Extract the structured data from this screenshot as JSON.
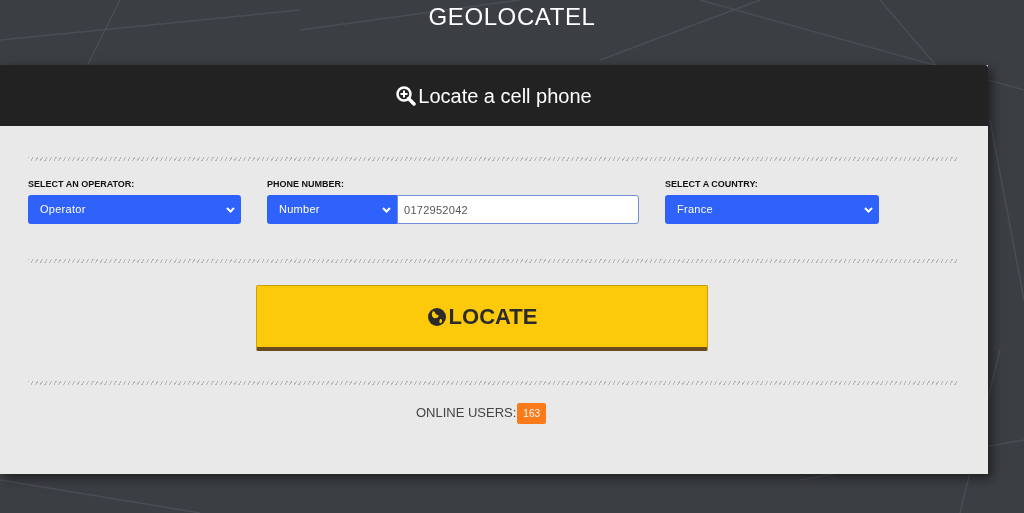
{
  "site_title": "GEOLOCATEL",
  "card": {
    "title": "Locate a cell phone"
  },
  "fields": [
    {
      "kind": "select",
      "label": "SELECT AN OPERATOR:",
      "value": "Operator"
    },
    {
      "kind": "phone",
      "label": "PHONE NUMBER:",
      "prefix": "Number",
      "value": "0172952042"
    },
    {
      "kind": "select",
      "label": "SELECT A COUNTRY:",
      "value": "France"
    }
  ],
  "locate_button": "LOCATE",
  "online_users": {
    "label": "ONLINE USERS:",
    "count": "163"
  }
}
